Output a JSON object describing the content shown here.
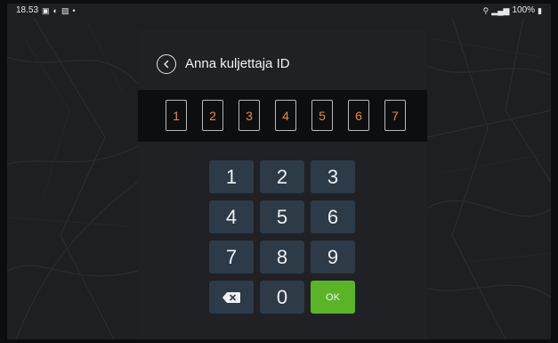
{
  "status_bar": {
    "time": "18.53",
    "battery": "100%"
  },
  "dialog": {
    "title": "Anna kuljettaja ID",
    "digits": [
      "1",
      "2",
      "3",
      "4",
      "5",
      "6",
      "7"
    ]
  },
  "keypad": {
    "k1": "1",
    "k2": "2",
    "k3": "3",
    "k4": "4",
    "k5": "5",
    "k6": "6",
    "k7": "7",
    "k8": "8",
    "k9": "9",
    "k0": "0",
    "ok": "OK"
  },
  "colors": {
    "digit_accent": "#f08a2c",
    "ok_button": "#5bb427",
    "key_bg": "#2d3a47"
  }
}
